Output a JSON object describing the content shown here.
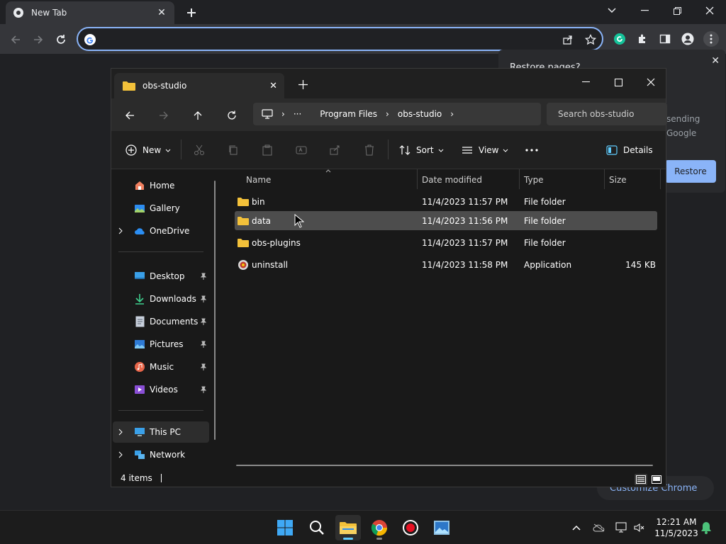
{
  "chrome": {
    "tab_title": "New Tab",
    "restore_title": "Restore pages?",
    "restore_text_1": "sending",
    "restore_text_2": "Google",
    "restore_button": "Restore",
    "customize_button": "Customize Chrome"
  },
  "explorer": {
    "tab_title": "obs-studio",
    "breadcrumb": [
      "Program Files",
      "obs-studio"
    ],
    "search_placeholder": "Search obs-studio",
    "commands": {
      "new": "New",
      "sort": "Sort",
      "view": "View",
      "details": "Details"
    },
    "sidebar": {
      "home": "Home",
      "gallery": "Gallery",
      "onedrive": "OneDrive",
      "desktop": "Desktop",
      "downloads": "Downloads",
      "documents": "Documents",
      "pictures": "Pictures",
      "music": "Music",
      "videos": "Videos",
      "thispc": "This PC",
      "network": "Network"
    },
    "columns": {
      "name": "Name",
      "date": "Date modified",
      "type": "Type",
      "size": "Size"
    },
    "files": [
      {
        "name": "bin",
        "date": "11/4/2023 11:57 PM",
        "type": "File folder",
        "size": ""
      },
      {
        "name": "data",
        "date": "11/4/2023 11:56 PM",
        "type": "File folder",
        "size": ""
      },
      {
        "name": "obs-plugins",
        "date": "11/4/2023 11:57 PM",
        "type": "File folder",
        "size": ""
      },
      {
        "name": "uninstall",
        "date": "11/4/2023 11:58 PM",
        "type": "Application",
        "size": "145 KB"
      }
    ],
    "status": "4 items"
  },
  "taskbar": {
    "time": "12:21 AM",
    "date": "11/5/2023"
  },
  "colors": {
    "accent": "#8ab4f8",
    "folder": "#f3c13a",
    "selection": "#4d4d4d"
  }
}
